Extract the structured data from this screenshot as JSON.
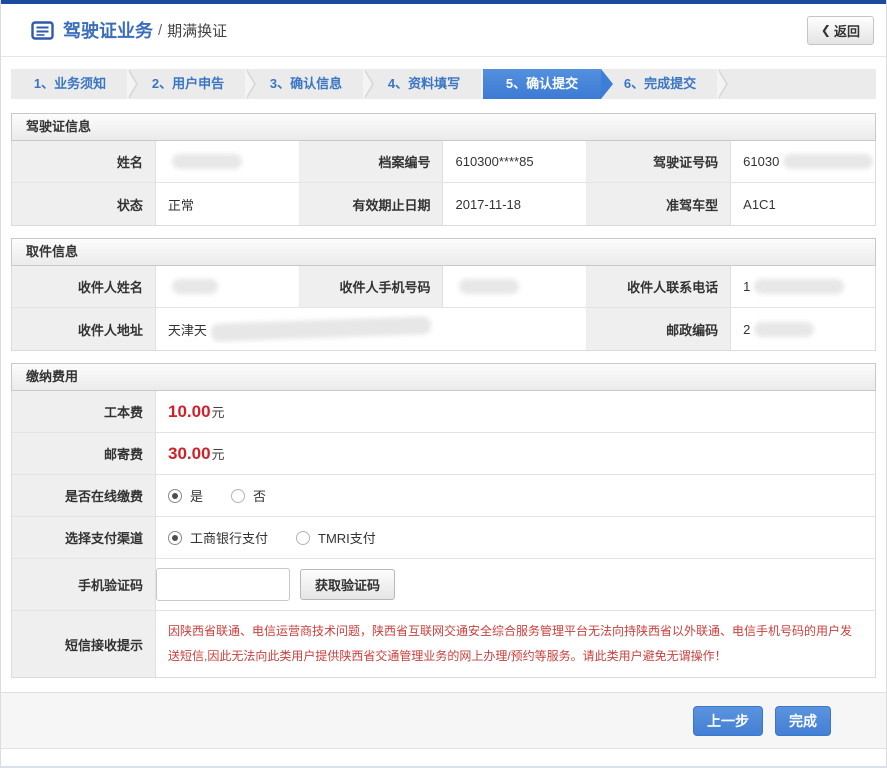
{
  "header": {
    "title": "驾驶证业务",
    "crumb_sep": "/",
    "subtitle": "期满换证",
    "back_icon": "❮",
    "back_label": "返回"
  },
  "steps": {
    "active_index": 4,
    "items": [
      {
        "label": "1、业务须知"
      },
      {
        "label": "2、用户申告"
      },
      {
        "label": "3、确认信息"
      },
      {
        "label": "4、资料填写"
      },
      {
        "label": "5、确认提交"
      },
      {
        "label": "6、完成提交"
      }
    ]
  },
  "license": {
    "title": "驾驶证信息",
    "name_label": "姓名",
    "name_value": "",
    "name_redacted": true,
    "file_label": "档案编号",
    "file_value": "610300****85",
    "licenseno_label": "驾驶证号码",
    "licenseno_value": "61030",
    "licenseno_redacted": true,
    "status_label": "状态",
    "status_value": "正常",
    "valid_label": "有效期止日期",
    "valid_value": "2017-11-18",
    "vehicle_label": "准驾车型",
    "vehicle_value": "A1C1"
  },
  "pickup": {
    "title": "取件信息",
    "name_label": "收件人姓名",
    "name_value": "",
    "name_redacted": true,
    "mobile_label": "收件人手机号码",
    "mobile_value": "",
    "mobile_redacted": true,
    "phone_label": "收件人联系电话",
    "phone_value": "1",
    "phone_redacted": true,
    "address_label": "收件人地址",
    "address_value": "天津天",
    "address_redacted": true,
    "postcode_label": "邮政编码",
    "postcode_value": "2",
    "postcode_redacted": true
  },
  "payment": {
    "title": "缴纳费用",
    "fee_label": "工本费",
    "fee_amount": "10.00",
    "fee_unit": "元",
    "mail_label": "邮寄费",
    "mail_amount": "30.00",
    "mail_unit": "元",
    "online_label": "是否在线缴费",
    "online_yes": "是",
    "online_no": "否",
    "online_selected": "是",
    "channel_label": "选择支付渠道",
    "channel_icbc": "工商银行支付",
    "channel_tmri": "TMRI支付",
    "channel_selected": "工商银行支付",
    "code_label": "手机验证码",
    "code_value": "",
    "code_placeholder": "",
    "code_button": "获取验证码",
    "notice_label": "短信接收提示",
    "notice_text": "因陕西省联通、电信运营商技术问题，陕西省互联网交通安全综合服务管理平台无法向持陕西省以外联通、电信手机号码的用户发送短信,因此无法向此类用户提供陕西省交通管理业务的网上办理/预约等服务。请此类用户避免无谓操作！"
  },
  "footer": {
    "prev_label": "上一步",
    "finish_label": "完成"
  },
  "colors": {
    "topbar_blue": "#1b4c9e",
    "title_blue": "#3a6ebc",
    "step_blue": "#3a76c4",
    "active_step_blue": "#3f7ed7",
    "fee_red": "#d0212b",
    "notice_red": "#c9403e",
    "button_blue": "#437fd4"
  }
}
